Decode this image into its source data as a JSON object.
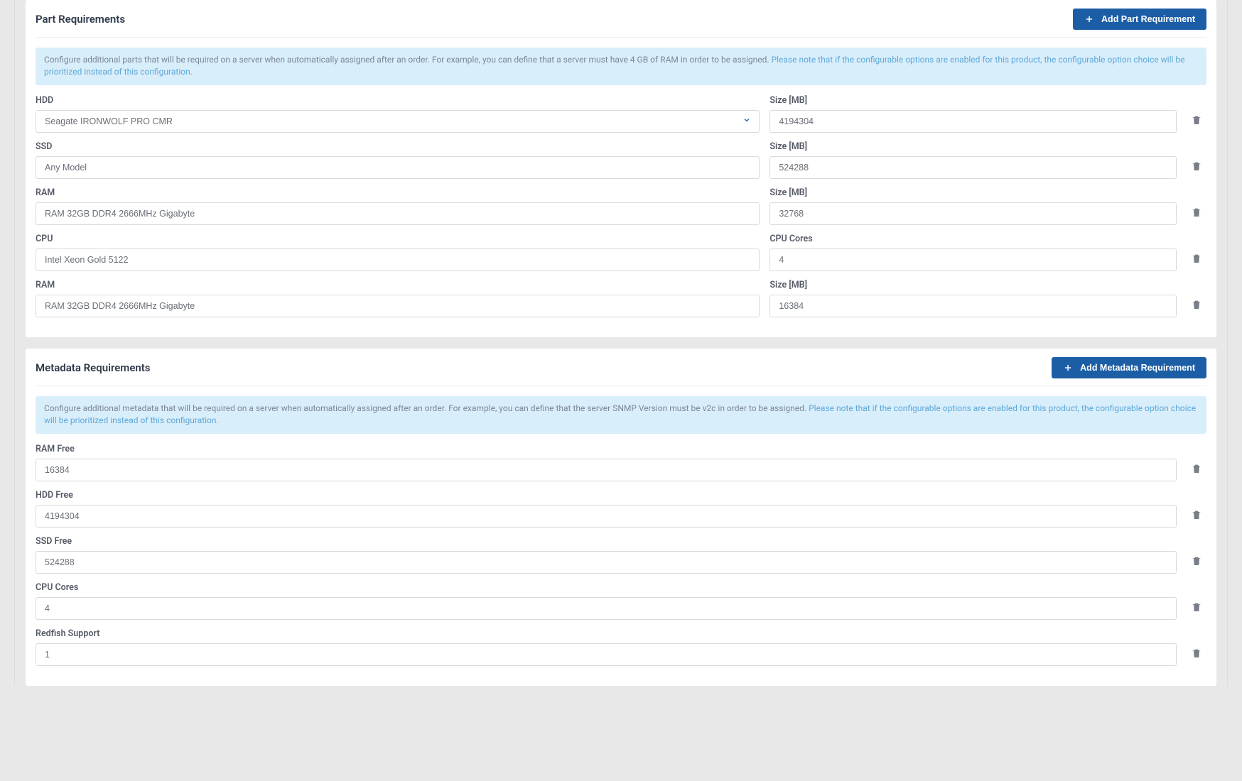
{
  "partRequirements": {
    "title": "Part Requirements",
    "addButton": "Add Part Requirement",
    "bannerMuted": "Configure additional parts that will be required on a server when automatically assigned after an order. For example, you can define that a server must have 4 GB of RAM in order to be assigned. ",
    "bannerHighlight": "Please note that if the configurable options are enabled for this product, the configurable option choice will be prioritized instead of this configuration.",
    "rows": [
      {
        "mainLabel": "HDD",
        "mainValue": "Seagate IRONWOLF PRO CMR",
        "mainIsSelect": true,
        "sideLabel": "Size [MB]",
        "sideValue": "4194304"
      },
      {
        "mainLabel": "SSD",
        "mainValue": "Any Model",
        "mainIsSelect": false,
        "sideLabel": "Size [MB]",
        "sideValue": "524288"
      },
      {
        "mainLabel": "RAM",
        "mainValue": "RAM 32GB DDR4 2666MHz Gigabyte",
        "mainIsSelect": false,
        "sideLabel": "Size [MB]",
        "sideValue": "32768"
      },
      {
        "mainLabel": "CPU",
        "mainValue": "Intel Xeon Gold 5122",
        "mainIsSelect": false,
        "sideLabel": "CPU Cores",
        "sideValue": "4"
      },
      {
        "mainLabel": "RAM",
        "mainValue": "RAM 32GB DDR4 2666MHz Gigabyte",
        "mainIsSelect": false,
        "sideLabel": "Size [MB]",
        "sideValue": "16384"
      }
    ]
  },
  "metadataRequirements": {
    "title": "Metadata Requirements",
    "addButton": "Add Metadata Requirement",
    "bannerMuted": "Configure additional metadata that will be required on a server when automatically assigned after an order. For example, you can define that the server SNMP Version must be v2c in order to be assigned. ",
    "bannerHighlight": "Please note that if the configurable options are enabled for this product, the configurable option choice will be prioritized instead of this configuration.",
    "rows": [
      {
        "label": "RAM Free",
        "value": "16384"
      },
      {
        "label": "HDD Free",
        "value": "4194304"
      },
      {
        "label": "SSD Free",
        "value": "524288"
      },
      {
        "label": "CPU Cores",
        "value": "4"
      },
      {
        "label": "Redfish Support",
        "value": "1"
      }
    ]
  }
}
